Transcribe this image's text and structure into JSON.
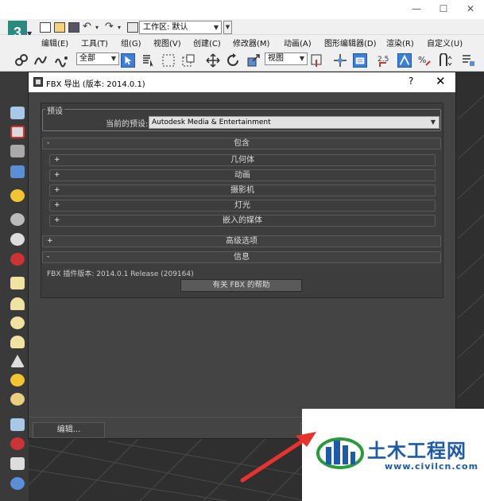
{
  "window": {
    "minimize": "—",
    "maximize": "☐",
    "close": "✕"
  },
  "app": {
    "logo": "3"
  },
  "quick_access": {
    "workspace_value": "工作区: 默认"
  },
  "menubar": {
    "items": [
      "编辑(E)",
      "工具(T)",
      "组(G)",
      "视图(V)",
      "创建(C)",
      "修改器(M)",
      "动画(A)",
      "图形编辑器(D)",
      "渲染(R)",
      "自定义(U)"
    ]
  },
  "toolbar": {
    "selection_filter": "全部",
    "reference_coord": "视图",
    "snap_label": "2.5"
  },
  "dialog": {
    "title": "FBX 导出 (版本: 2014.0.1)",
    "help": "?",
    "close": "✕",
    "presets_legend": "预设",
    "current_preset_label": "当前的预设:",
    "current_preset_value": "Autodesk Media & Entertainment",
    "include": {
      "sign": "-",
      "label": "包含"
    },
    "include_items": [
      {
        "sign": "+",
        "label": "几何体"
      },
      {
        "sign": "+",
        "label": "动画"
      },
      {
        "sign": "+",
        "label": "摄影机"
      },
      {
        "sign": "+",
        "label": "灯光"
      },
      {
        "sign": "+",
        "label": "嵌入的媒体"
      }
    ],
    "advanced": {
      "sign": "+",
      "label": "高级选项"
    },
    "information": {
      "sign": "-",
      "label": "信息"
    },
    "plugin_version": "FBX 插件版本: 2014.0.1 Release (209164)",
    "help_button": "有关 FBX 的帮助",
    "edit_button": "编辑..."
  },
  "watermark": {
    "title": "土木工程网",
    "url": "www.civilcn.com",
    "accent_color": "#1d5aa8",
    "arrow_color": "#e8322d"
  }
}
